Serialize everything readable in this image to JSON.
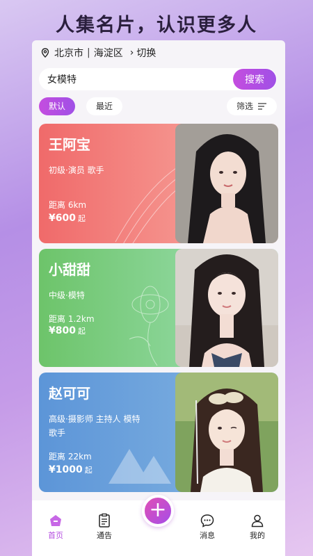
{
  "headline": "人集名片，认识更多人",
  "location": {
    "city": "北京市",
    "district": "海淀区",
    "switch_label": "切换"
  },
  "search": {
    "value": "女模特",
    "button_label": "搜索"
  },
  "filters": {
    "default_label": "默认",
    "recent_label": "最近",
    "filter_label": "筛选"
  },
  "cards": [
    {
      "name": "王阿宝",
      "role": "初级·演员  歌手",
      "distance": "距离 6km",
      "price": "¥600",
      "price_unit": "起",
      "color": "#f06a6a"
    },
    {
      "name": "小甜甜",
      "role": "中级·模特",
      "distance": "距离 1.2km",
      "price": "¥800",
      "price_unit": "起",
      "color": "#6dc46a"
    },
    {
      "name": "赵可可",
      "role": "高级·摄影师  主持人  模特\n歌手",
      "role_line1": "高级·摄影师  主持人  模特",
      "role_line2": "歌手",
      "distance": "距离 22km",
      "price": "¥1000",
      "price_unit": "起",
      "color": "#5c95d8"
    }
  ],
  "tabbar": {
    "home": "首页",
    "notice": "通告",
    "add": "+",
    "messages": "消息",
    "me": "我的",
    "active_color": "#b44de0"
  },
  "icons": {
    "location": "map-pin-icon",
    "filter": "filter-lines-icon",
    "home": "home-icon",
    "notice": "clipboard-icon",
    "messages": "chat-bubble-icon",
    "me": "user-icon"
  }
}
